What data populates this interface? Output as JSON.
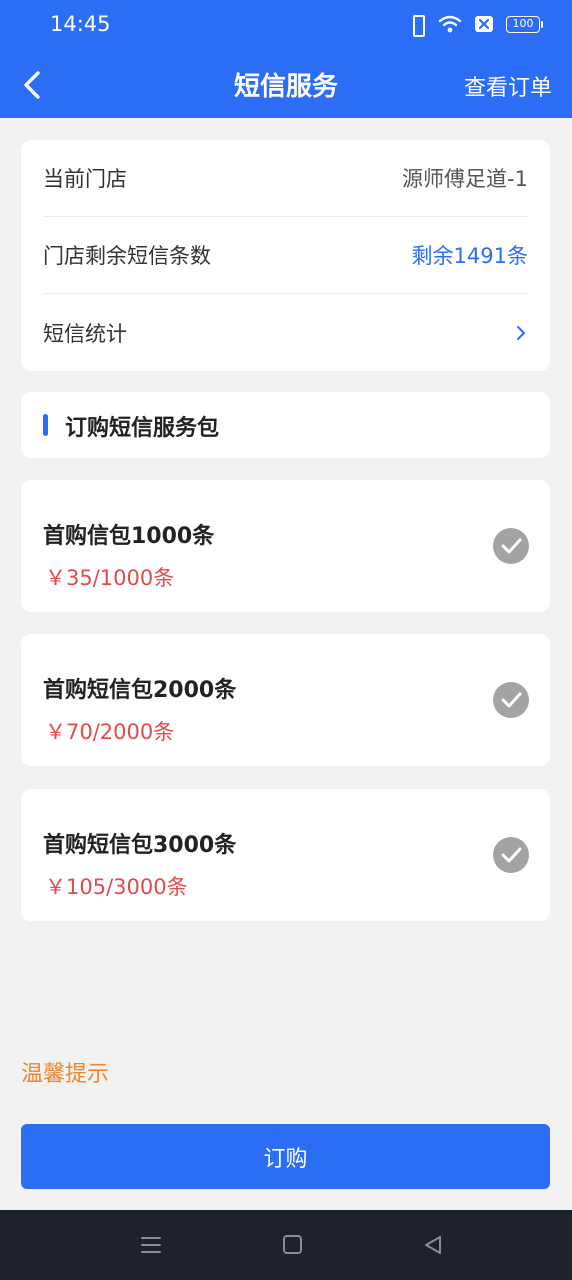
{
  "status": {
    "time": "14:45",
    "battery": "100"
  },
  "nav": {
    "title": "短信服务",
    "action": "查看订单"
  },
  "info": {
    "store_label": "当前门店",
    "store_value": "源师傅足道-1",
    "remaining_label": "门店剩余短信条数",
    "remaining_value": "剩余1491条",
    "stats_label": "短信统计"
  },
  "section": {
    "title": "订购短信服务包"
  },
  "packages": [
    {
      "name": "首购信包1000条",
      "price": "￥35/1000条"
    },
    {
      "name": "首购短信包2000条",
      "price": "￥70/2000条"
    },
    {
      "name": "首购短信包3000条",
      "price": "￥105/3000条"
    }
  ],
  "tips": "温馨提示",
  "buy_label": "订购",
  "colors": {
    "primary": "#2b6ef5",
    "price": "#e34b4b",
    "tips": "#f0862e",
    "check": "#a3a3a3"
  }
}
